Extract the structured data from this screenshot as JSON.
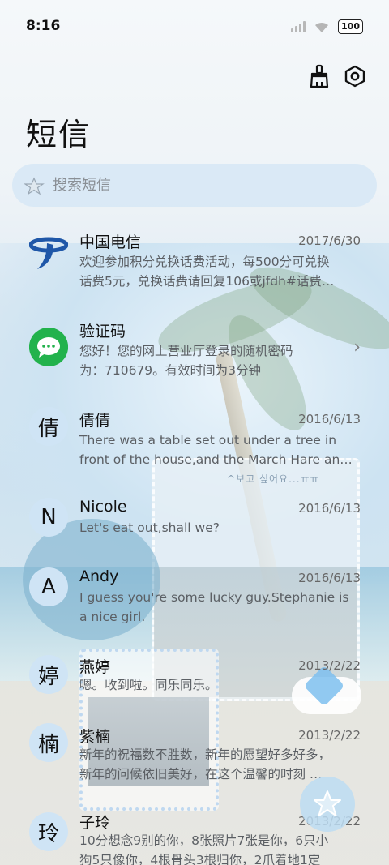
{
  "status_bar": {
    "time": "8:16",
    "battery": "100"
  },
  "page": {
    "title": "短信"
  },
  "search": {
    "placeholder": "搜索短信"
  },
  "background": {
    "deco_text": "^보고 싶어요...ㅠㅠ"
  },
  "conversations": [
    {
      "avatar": "",
      "avatar_icon": "china-telecom-logo",
      "name": "中国电信",
      "date": "2017/6/30",
      "line1": "欢迎参加积分兑换话费活动，每500分可兑换",
      "line2": "话费5元，兑换话费请回复106或jfdh#话费…"
    },
    {
      "avatar": "",
      "avatar_icon": "message-bubble-icon",
      "name": "验证码",
      "date": "",
      "line1": "您好！您的网上营业厅登录的随机密码",
      "line2": "为：710679。有效时间为3分钟"
    },
    {
      "avatar": "倩",
      "name": "倩倩",
      "date": "2016/6/13",
      "line1": "There was a table set out under a tree in",
      "line2": "front of the house,and the March Hare an…"
    },
    {
      "avatar": "N",
      "name": "Nicole",
      "date": "2016/6/13",
      "line1": "Let's eat out,shall we?",
      "line2": ""
    },
    {
      "avatar": "A",
      "name": "Andy",
      "date": "2016/6/13",
      "line1": "I guess you're some lucky guy.Stephanie is",
      "line2": "a nice girl."
    },
    {
      "avatar": "婷",
      "name": "燕婷",
      "date": "2013/2/22",
      "line1": "嗯。收到啦。同乐同乐。",
      "line2": ""
    },
    {
      "avatar": "楠",
      "name": "紫楠",
      "date": "2013/2/22",
      "line1": "新年的祝福数不胜数，新年的愿望好多好多，",
      "line2": "新年的问候依旧美好，在这个温馨的时刻 …"
    },
    {
      "avatar": "玲",
      "name": "子玲",
      "date": "2013/2/22",
      "line1": "10分想念9别的你，8张照片7张是你，6只小",
      "line2": "狗5只像你，4根骨头3根归你，2爪着地1定"
    }
  ],
  "colors": {
    "accent": "#cfe4f5",
    "search_bg": "#d7e8f5",
    "telecom_blue": "#1f57a8",
    "msg_green": "#22b24c"
  }
}
